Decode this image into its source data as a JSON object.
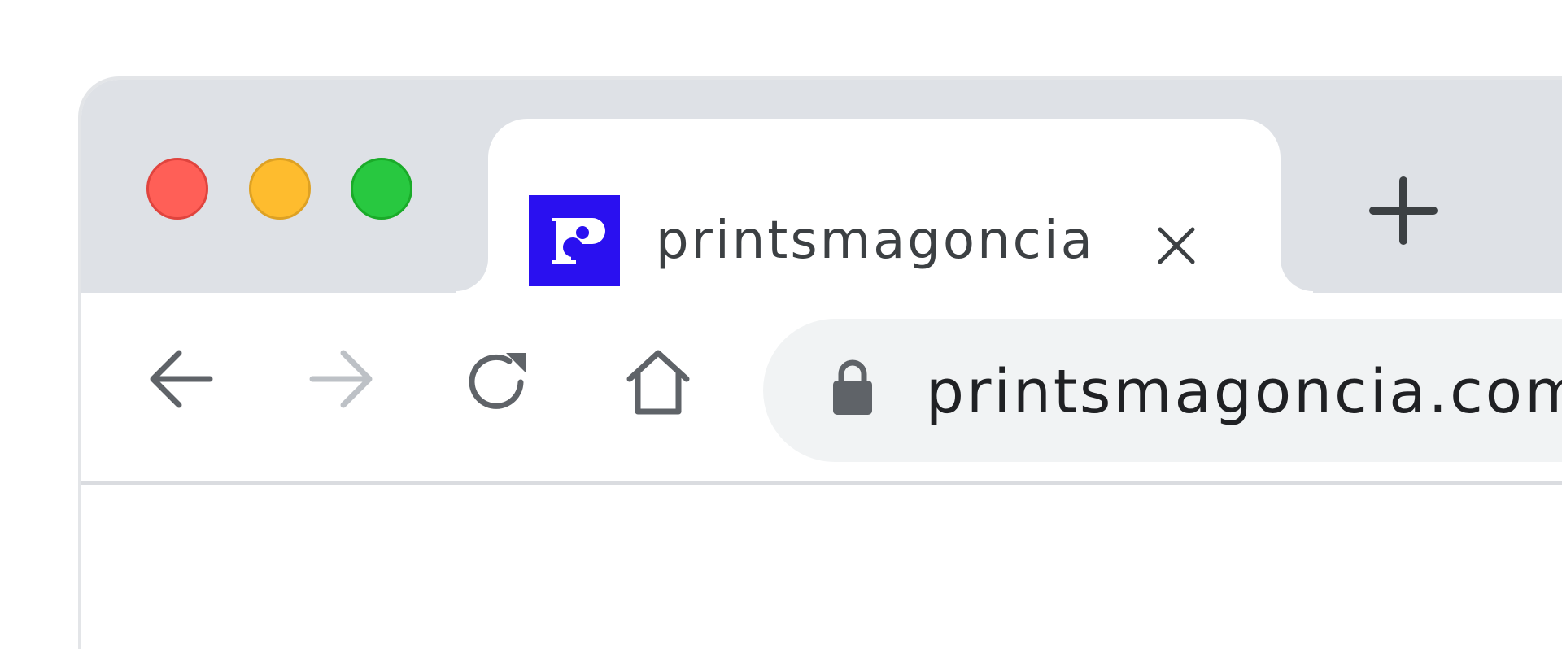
{
  "window": {
    "traffic_lights": [
      "close",
      "minimize",
      "zoom"
    ]
  },
  "tab": {
    "title": "printsmagoncia",
    "favicon_icon": "printsmagoncia-logo-icon",
    "favicon_color": "#2a10f0",
    "close_icon": "close-icon"
  },
  "new_tab_icon": "plus-icon",
  "toolbar": {
    "back_icon": "arrow-left-icon",
    "forward_icon": "arrow-right-icon",
    "reload_icon": "reload-icon",
    "home_icon": "home-icon"
  },
  "omnibox": {
    "lock_icon": "lock-icon",
    "url": "printsmagoncia.com"
  }
}
